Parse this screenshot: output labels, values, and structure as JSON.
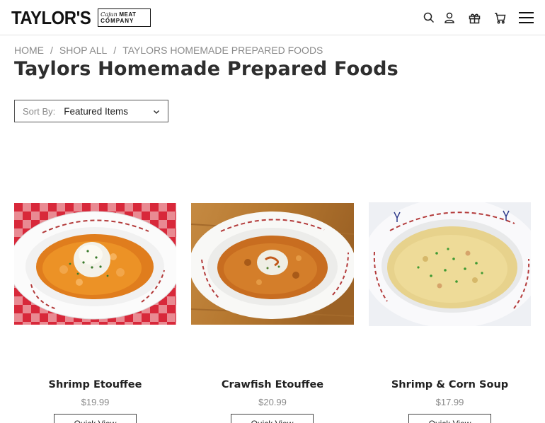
{
  "header": {
    "logo_main": "TAYLOR'S",
    "logo_script": "Cajun",
    "logo_meat": "MEAT",
    "logo_company": "COMPANY",
    "icons": [
      "search-icon",
      "account-icon",
      "gift-icon",
      "cart-icon",
      "menu-icon"
    ]
  },
  "breadcrumb": {
    "items": [
      "HOME",
      "SHOP ALL",
      "TAYLORS HOMEMADE PREPARED FOODS"
    ],
    "separator": "/"
  },
  "page_title": "Taylors Homemade Prepared Foods",
  "sort": {
    "label": "Sort By:",
    "selected": "Featured Items"
  },
  "products": [
    {
      "name": "Shrimp Etouffee",
      "price": "$19.99",
      "quick_view": "Quick View"
    },
    {
      "name": "Crawfish Etouffee",
      "price": "$20.99",
      "quick_view": "Quick View"
    },
    {
      "name": "Shrimp & Corn Soup",
      "price": "$17.99",
      "quick_view": "Quick View"
    }
  ],
  "colors": {
    "title": "#2e2e2e",
    "muted": "#8a8a8a",
    "tablecloth_red": "#d8283a",
    "bowl_script": "#b33a3a"
  }
}
